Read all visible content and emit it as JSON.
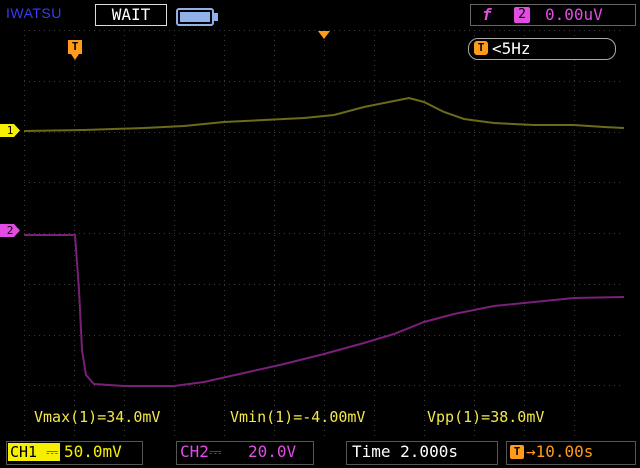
{
  "header": {
    "brand": "IWATSU",
    "run_state": "WAIT",
    "trigger_slope_icon": "rising-edge-icon",
    "trigger_source": "2",
    "trigger_level": "0.00uV"
  },
  "screen": {
    "trigger_frequency": "<5Hz",
    "trigger_marker": "T",
    "ch1_marker": "1",
    "ch2_marker": "2",
    "ch1_color": "#6b6b1a",
    "ch2_color": "#7a1f7a",
    "grid_color": "#3a3a3a"
  },
  "measurements": {
    "vmax": "Vmax(1)=34.0mV",
    "vmin": "Vmin(1)=-4.00mV",
    "vpp": "Vpp(1)=38.0mV"
  },
  "footer": {
    "ch1_label": "CH1",
    "ch1_scale": "50.0mV",
    "ch2_label": "CH2",
    "ch2_scale": "20.0V",
    "timebase": "Time 2.000s",
    "trigger_delay": "10.00s"
  }
}
